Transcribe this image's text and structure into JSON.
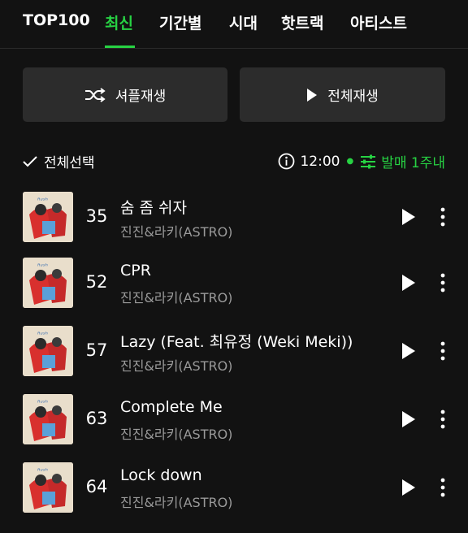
{
  "tabs": [
    {
      "label": "TOP100",
      "active": false
    },
    {
      "label": "최신",
      "active": true
    },
    {
      "label": "기간별",
      "active": false
    },
    {
      "label": "시대",
      "active": false
    },
    {
      "label": "핫트랙",
      "active": false
    },
    {
      "label": "아티스트",
      "active": false
    }
  ],
  "actions": {
    "shuffle_label": "셔플재생",
    "play_all_label": "전체재생"
  },
  "list_controls": {
    "select_all_label": "전체선택",
    "time": "12:00",
    "filter_label": "발매 1주내"
  },
  "tracks": [
    {
      "rank": "35",
      "title": "숨 좀 쉬자",
      "artist": "진진&라키(ASTRO)"
    },
    {
      "rank": "52",
      "title": "CPR",
      "artist": "진진&라키(ASTRO)"
    },
    {
      "rank": "57",
      "title": "Lazy (Feat. 최유정 (Weki Meki))",
      "artist": "진진&라키(ASTRO)"
    },
    {
      "rank": "63",
      "title": "Complete Me",
      "artist": "진진&라키(ASTRO)"
    },
    {
      "rank": "64",
      "title": "Lock down",
      "artist": "진진&라키(ASTRO)"
    }
  ],
  "colors": {
    "accent": "#27d243",
    "background": "#121212",
    "button_bg": "#2c2c2c",
    "secondary_text": "#9a9a9a"
  }
}
